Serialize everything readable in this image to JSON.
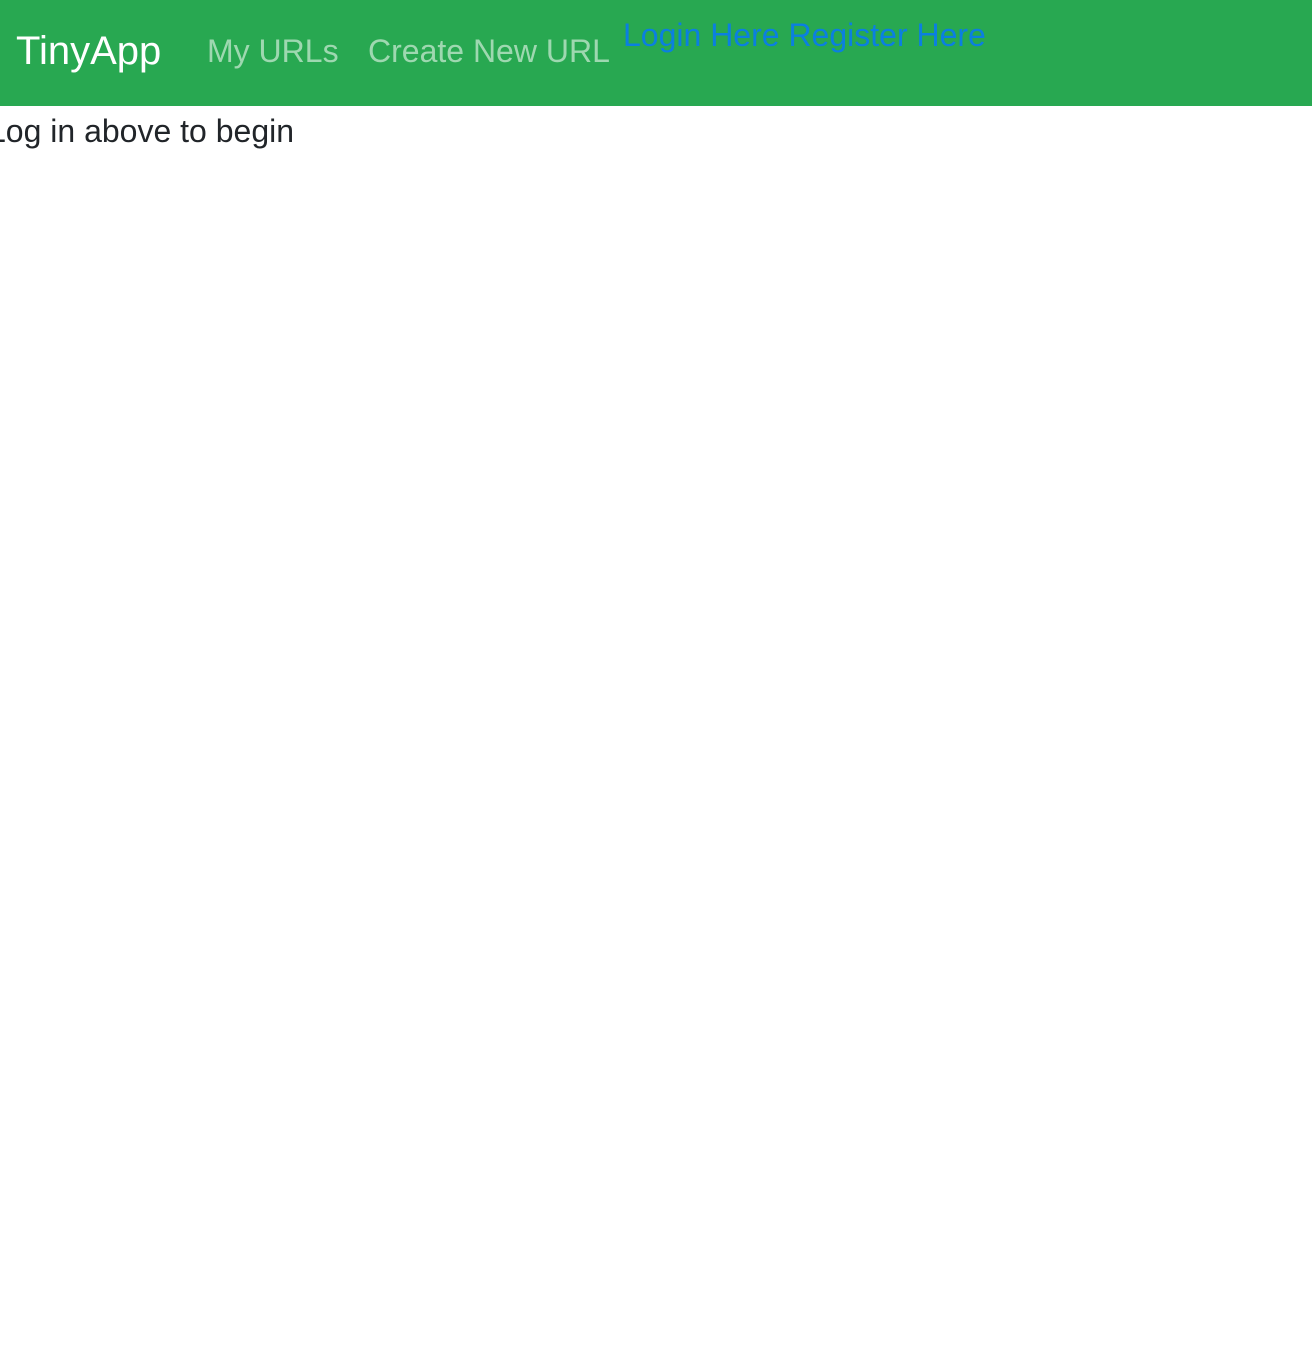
{
  "navbar": {
    "brand": "TinyApp",
    "links": [
      {
        "label": "My URLs"
      },
      {
        "label": "Create New URL"
      }
    ],
    "auth": {
      "login_label": "Login Here",
      "register_label": "Register Here"
    },
    "colors": {
      "background": "#28a851",
      "auth_link": "#0b7fe0"
    }
  },
  "main": {
    "message": "Log in above to begin"
  }
}
